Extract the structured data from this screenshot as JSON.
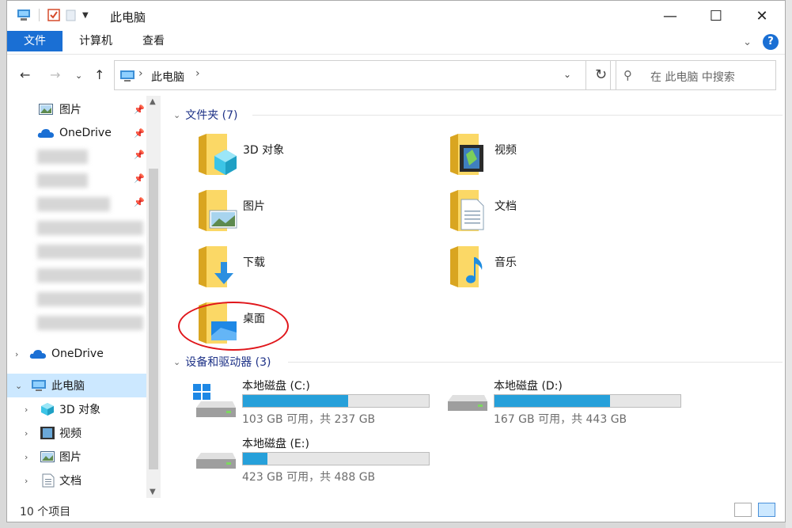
{
  "window": {
    "title": "此电脑"
  },
  "ribbon": {
    "tabs": [
      "文件",
      "计算机",
      "查看"
    ]
  },
  "address": {
    "crumb": "此电脑"
  },
  "search": {
    "placeholder": "在 此电脑 中搜索"
  },
  "sidebar": {
    "quick_items": [
      {
        "label": "图片",
        "icon": "pictures-icon"
      },
      {
        "label": "OneDrive",
        "icon": "onedrive-icon"
      }
    ],
    "tree": [
      {
        "label": "OneDrive",
        "icon": "onedrive-icon"
      },
      {
        "label": "此电脑",
        "icon": "computer-icon"
      },
      {
        "label": "3D 对象",
        "icon": "3d-objects-icon"
      },
      {
        "label": "视频",
        "icon": "videos-icon"
      },
      {
        "label": "图片",
        "icon": "pictures-icon"
      },
      {
        "label": "文档",
        "icon": "documents-icon"
      }
    ]
  },
  "folders": {
    "header": "文件夹 (7)",
    "items": [
      {
        "name": "3D 对象",
        "icon": "3d-objects-folder-icon"
      },
      {
        "name": "视频",
        "icon": "videos-folder-icon"
      },
      {
        "name": "图片",
        "icon": "pictures-folder-icon"
      },
      {
        "name": "文档",
        "icon": "documents-folder-icon"
      },
      {
        "name": "下载",
        "icon": "downloads-folder-icon"
      },
      {
        "name": "音乐",
        "icon": "music-folder-icon"
      },
      {
        "name": "桌面",
        "icon": "desktop-folder-icon"
      }
    ]
  },
  "drives": {
    "header": "设备和驱动器 (3)",
    "items": [
      {
        "name": "本地磁盘 (C:)",
        "info": "103 GB 可用，共 237 GB",
        "used_fraction": 0.565
      },
      {
        "name": "本地磁盘 (D:)",
        "info": "167 GB 可用，共 443 GB",
        "used_fraction": 0.623
      },
      {
        "name": "本地磁盘 (E:)",
        "info": "423 GB 可用，共 488 GB",
        "used_fraction": 0.133
      }
    ]
  },
  "status": {
    "count": "10 个项目"
  },
  "colors": {
    "accent": "#1a6fd4",
    "drive_fill": "#26a0da",
    "selection": "#cce8ff",
    "annotation": "#e0161b"
  }
}
